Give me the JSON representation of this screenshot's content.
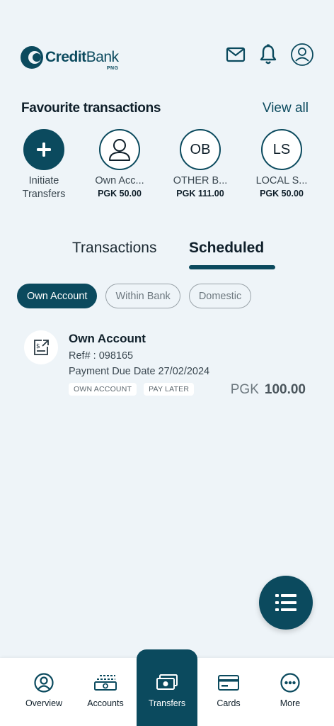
{
  "brand": {
    "credit": "Credit",
    "bank": "Bank",
    "suffix": "PNG"
  },
  "favourites": {
    "title": "Favourite transactions",
    "view_all": "View all",
    "items": [
      {
        "initials": "+",
        "name_line1": "Initiate",
        "name_line2": "Transfers",
        "amount": ""
      },
      {
        "initials": "",
        "name_line1": "Own Acc...",
        "amount": "PGK 50.00"
      },
      {
        "initials": "OB",
        "name_line1": "OTHER B...",
        "amount": "PGK 111.00"
      },
      {
        "initials": "LS",
        "name_line1": "LOCAL S...",
        "amount": "PGK 50.00"
      }
    ]
  },
  "tabs": [
    {
      "label": "Transactions",
      "active": false
    },
    {
      "label": "Scheduled",
      "active": true
    }
  ],
  "filters": [
    {
      "label": "Own Account",
      "active": true
    },
    {
      "label": "Within Bank",
      "active": false
    },
    {
      "label": "Domestic",
      "active": false
    }
  ],
  "transaction": {
    "title": "Own Account",
    "ref": "Ref# : 098165",
    "due": "Payment Due Date 27/02/2024",
    "tags": [
      "OWN ACCOUNT",
      "PAY LATER"
    ],
    "currency": "PGK",
    "amount": "100.00"
  },
  "nav": [
    {
      "label": "Overview",
      "icon": "overview-icon"
    },
    {
      "label": "Accounts",
      "icon": "accounts-icon"
    },
    {
      "label": "Transfers",
      "icon": "transfers-icon",
      "active": true
    },
    {
      "label": "Cards",
      "icon": "cards-icon"
    },
    {
      "label": "More",
      "icon": "more-icon"
    }
  ],
  "colors": {
    "primary": "#0b4a5e",
    "background": "#eef4f8"
  }
}
